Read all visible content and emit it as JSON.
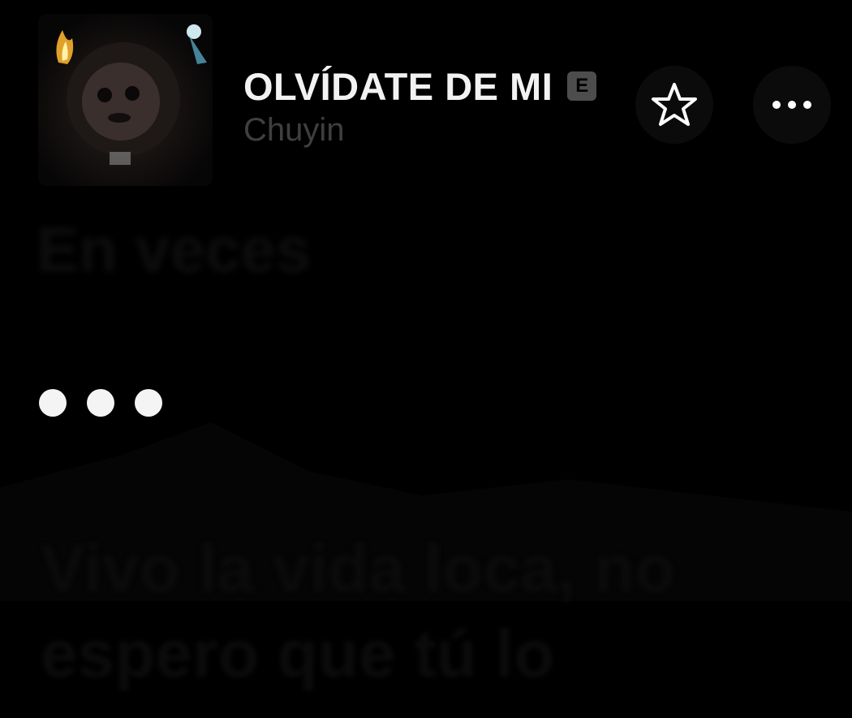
{
  "now_playing": {
    "title": "OLVÍDATE DE MI",
    "explicit_badge": "E",
    "artist": "Chuyin"
  },
  "icons": {
    "favorite": "star-icon",
    "more": "more-horizontal-icon"
  },
  "lyrics": {
    "previous_line": "En veces",
    "current": "instrumental-break",
    "next_line_1": "Vivo la vida loca, no",
    "next_line_2": "espero que tú lo"
  },
  "colors": {
    "background": "#000000",
    "title": "#f2f2f2",
    "artist": "#3f3f3f",
    "badge": "#4d4d4d",
    "dots": "#f4f4f4"
  }
}
